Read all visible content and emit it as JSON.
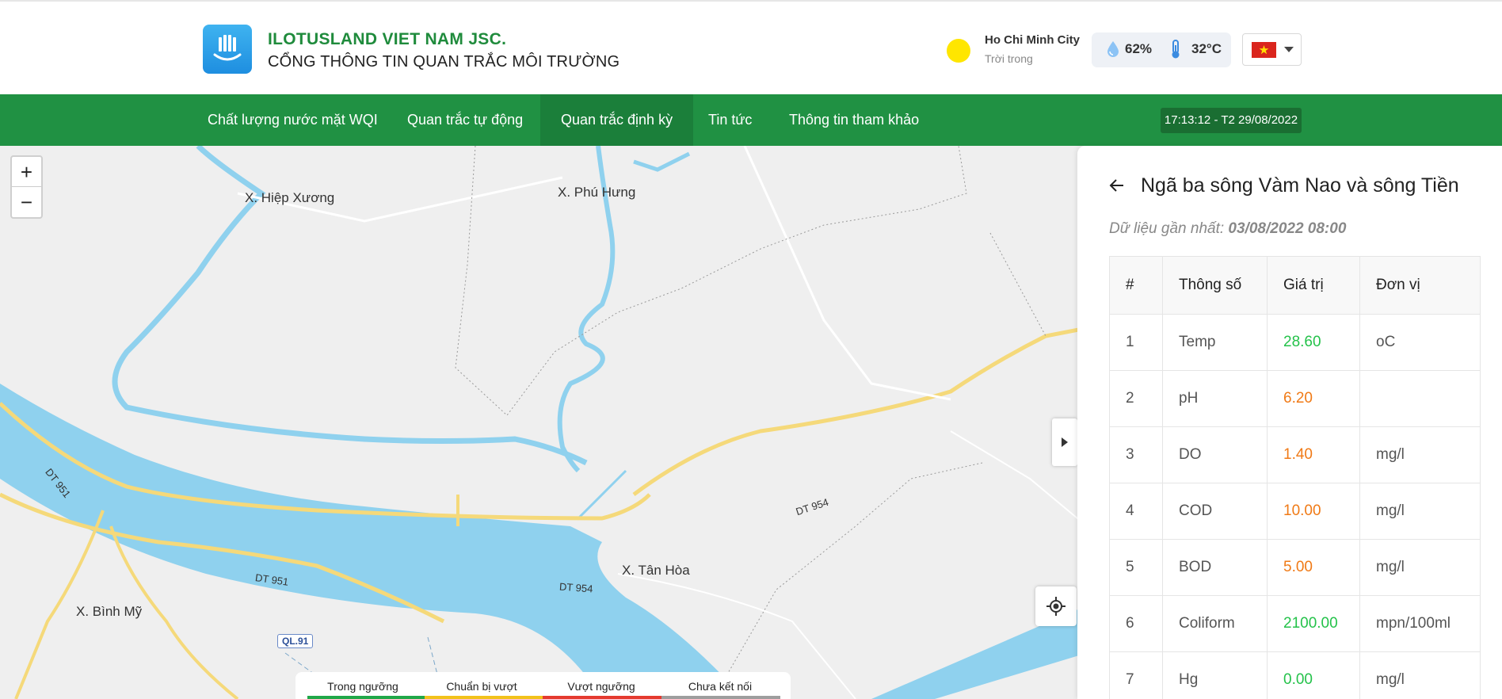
{
  "header": {
    "brand_name": "ILOTUSLAND VIET NAM JSC.",
    "brand_sub": "CỔNG THÔNG TIN QUAN TRẮC MÔI TRƯỜNG",
    "city": "Ho Chi Minh City",
    "weather_desc": "Trời trong",
    "humidity": "62%",
    "temperature": "32°C",
    "sun_color": "#ffe600"
  },
  "nav": {
    "items": [
      "Chất lượng nước mặt WQI",
      "Quan trắc tự động",
      "Quan trắc định kỳ",
      "Tin tức",
      "Thông tin tham khảo"
    ],
    "active_index": 2,
    "clock": "17:13:12 - T2 29/08/2022",
    "color": "#209143"
  },
  "map": {
    "places": [
      "X. Hiệp Xương",
      "X. Phú Hưng",
      "X. Tân Hòa",
      "X. Bình Mỹ"
    ],
    "roads": [
      "DT 951",
      "DT 951",
      "DT 954",
      "DT 954"
    ],
    "shield": "QL.91",
    "zoom_in": "+",
    "zoom_out": "−"
  },
  "legend": [
    {
      "label": "Trong ngưỡng",
      "color": "#20a848"
    },
    {
      "label": "Chuẩn bị vượt",
      "color": "#f2c21b"
    },
    {
      "label": "Vượt ngưỡng",
      "color": "#e53a2f"
    },
    {
      "label": "Chưa kết nối",
      "color": "#9e9e9e"
    }
  ],
  "panel": {
    "station": "Ngã ba sông Vàm Nao và sông Tiền",
    "latest_label": "Dữ liệu gần nhất:",
    "latest_time": "03/08/2022 08:00",
    "columns": [
      "#",
      "Thông số",
      "Giá trị",
      "Đơn vị"
    ],
    "rows": [
      {
        "no": "1",
        "param": "Temp",
        "value": "28.60",
        "unit": "oC",
        "status": "green"
      },
      {
        "no": "2",
        "param": "pH",
        "value": "6.20",
        "unit": "",
        "status": "orange"
      },
      {
        "no": "3",
        "param": "DO",
        "value": "1.40",
        "unit": "mg/l",
        "status": "orange"
      },
      {
        "no": "4",
        "param": "COD",
        "value": "10.00",
        "unit": "mg/l",
        "status": "orange"
      },
      {
        "no": "5",
        "param": "BOD",
        "value": "5.00",
        "unit": "mg/l",
        "status": "orange"
      },
      {
        "no": "6",
        "param": "Coliform",
        "value": "2100.00",
        "unit": "mpn/100ml",
        "status": "green"
      },
      {
        "no": "7",
        "param": "Hg",
        "value": "0.00",
        "unit": "mg/l",
        "status": "green"
      }
    ]
  }
}
